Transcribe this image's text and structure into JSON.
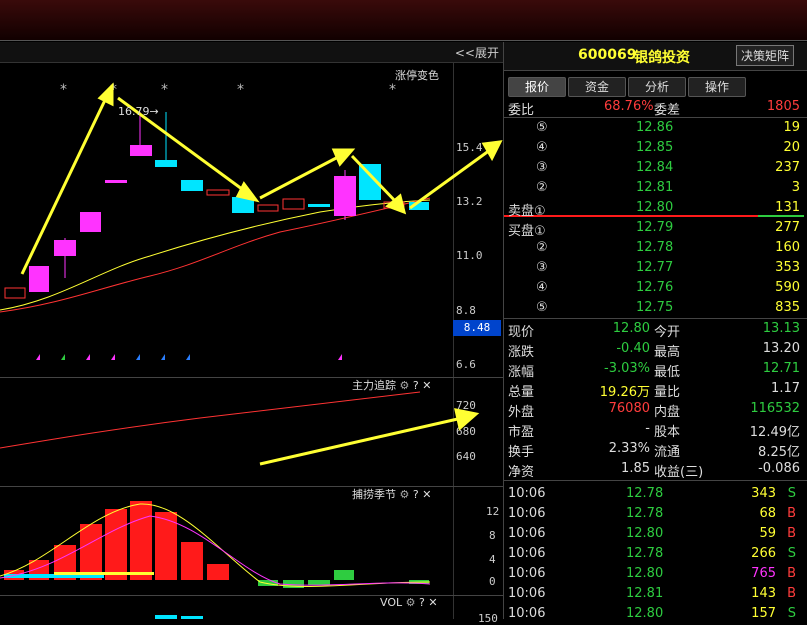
{
  "header": {
    "code": "600069",
    "name": "银鸽投资",
    "decision_button": "决策矩阵",
    "expand": "<<展开"
  },
  "main_chart": {
    "panel_label": "涨停变色",
    "peak_label": "16.79→",
    "y_ticks": [
      "15.4",
      "13.2",
      "11.0",
      "8.8",
      "6.6"
    ],
    "current_tag": "8.48"
  },
  "indicator1": {
    "title": "主力追踪",
    "y_ticks": [
      "720",
      "680",
      "640"
    ]
  },
  "indicator2": {
    "title": "捕捞季节",
    "y_ticks": [
      "12",
      "8",
      "4",
      "0"
    ]
  },
  "indicator3": {
    "title": "VOL",
    "y_ticks": [
      "150"
    ]
  },
  "tabs": [
    "报价",
    "资金",
    "分析",
    "操作"
  ],
  "order_ratio": {
    "label1": "委比",
    "value1": "68.76%",
    "label2": "委差",
    "value2": "1805"
  },
  "sell": [
    {
      "label": "⑤",
      "price": "12.86",
      "vol": "19"
    },
    {
      "label": "④",
      "price": "12.85",
      "vol": "20"
    },
    {
      "label": "③",
      "price": "12.84",
      "vol": "237"
    },
    {
      "label": "②",
      "price": "12.81",
      "vol": "3"
    },
    {
      "label": "卖盘①",
      "price": "12.80",
      "vol": "131"
    }
  ],
  "buy": [
    {
      "label": "买盘①",
      "price": "12.79",
      "vol": "277"
    },
    {
      "label": "②",
      "price": "12.78",
      "vol": "160"
    },
    {
      "label": "③",
      "price": "12.77",
      "vol": "353"
    },
    {
      "label": "④",
      "price": "12.76",
      "vol": "590"
    },
    {
      "label": "⑤",
      "price": "12.75",
      "vol": "835"
    }
  ],
  "stats": [
    {
      "l1": "现价",
      "v1": "12.80",
      "c1": "green",
      "l2": "今开",
      "v2": "13.13",
      "c2": "green"
    },
    {
      "l1": "涨跌",
      "v1": "-0.40",
      "c1": "green",
      "l2": "最高",
      "v2": "13.20",
      "c2": "white"
    },
    {
      "l1": "涨幅",
      "v1": "-3.03%",
      "c1": "green",
      "l2": "最低",
      "v2": "12.71",
      "c2": "green"
    },
    {
      "l1": "总量",
      "v1": "19.26万",
      "c1": "yellow",
      "l2": "量比",
      "v2": "1.17",
      "c2": "white"
    },
    {
      "l1": "外盘",
      "v1": "76080",
      "c1": "red",
      "l2": "内盘",
      "v2": "116532",
      "c2": "green"
    },
    {
      "l1": "市盈",
      "v1": "-",
      "c1": "white",
      "l2": "股本",
      "v2": "12.49亿",
      "c2": "white"
    },
    {
      "l1": "换手",
      "v1": "2.33%",
      "c1": "white",
      "l2": "流通",
      "v2": "8.25亿",
      "c2": "white"
    },
    {
      "l1": "净资",
      "v1": "1.85",
      "c1": "white",
      "l2": "收益(三)",
      "v2": "-0.086",
      "c2": "white"
    }
  ],
  "ticks": [
    {
      "time": "10:06",
      "price": "12.78",
      "vol": "343",
      "bs": "S",
      "vc": "yellow"
    },
    {
      "time": "10:06",
      "price": "12.78",
      "vol": "68",
      "bs": "B",
      "vc": "yellow"
    },
    {
      "time": "10:06",
      "price": "12.80",
      "vol": "59",
      "bs": "B",
      "vc": "yellow"
    },
    {
      "time": "10:06",
      "price": "12.78",
      "vol": "266",
      "bs": "S",
      "vc": "yellow"
    },
    {
      "time": "10:06",
      "price": "12.80",
      "vol": "765",
      "bs": "B",
      "vc": "mag"
    },
    {
      "time": "10:06",
      "price": "12.81",
      "vol": "143",
      "bs": "B",
      "vc": "yellow"
    },
    {
      "time": "10:06",
      "price": "12.80",
      "vol": "157",
      "bs": "S",
      "vc": "yellow"
    }
  ],
  "colors": {
    "up": "#ff1a1a",
    "down": "#00e5ff",
    "arrow": "#ffff33",
    "ma5": "#ffff33",
    "ma10": "#ff3333"
  }
}
